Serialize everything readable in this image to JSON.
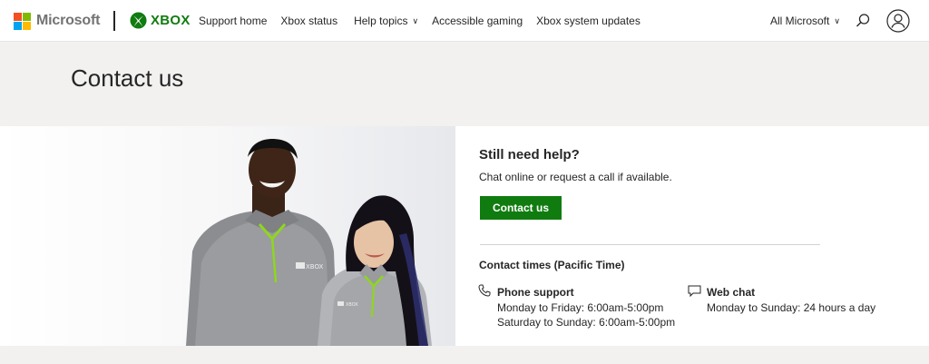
{
  "header": {
    "brand": "Microsoft",
    "product": "XBOX",
    "nav": [
      {
        "label": "Support home"
      },
      {
        "label": "Xbox status"
      },
      {
        "label": "Help topics"
      },
      {
        "label": "Accessible gaming"
      },
      {
        "label": "Xbox system updates"
      }
    ],
    "all_microsoft": "All Microsoft",
    "icons": {
      "search": "search-icon",
      "account": "account-icon"
    }
  },
  "hero": {
    "title": "Contact us"
  },
  "help": {
    "title": "Still need help?",
    "subtitle": "Chat online or request a call if available.",
    "button_label": "Contact us",
    "times_title": "Contact times (Pacific Time)",
    "phone": {
      "title": "Phone support",
      "line1": "Monday to Friday: 6:00am-5:00pm",
      "line2": "Saturday to Sunday: 6:00am-5:00pm",
      "icon": "phone-icon"
    },
    "chat": {
      "title": "Web chat",
      "line1": "Monday to Sunday: 24 hours a day",
      "icon": "chat-icon"
    }
  },
  "colors": {
    "xbox_green": "#107c10",
    "hero_bg": "#f2f1f0",
    "ms_red": "#f25022",
    "ms_green": "#7fba00",
    "ms_blue": "#00a4ef",
    "ms_yellow": "#ffb900"
  }
}
